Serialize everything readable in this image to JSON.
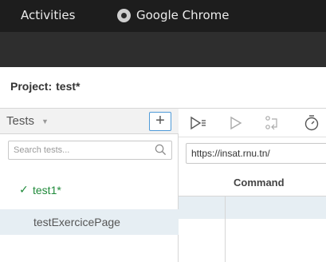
{
  "topbar": {
    "activities_label": "Activities",
    "app_name": "Google Chrome"
  },
  "project": {
    "label": "Project:",
    "name": "test*"
  },
  "tests_panel": {
    "title": "Tests",
    "add_label": "+",
    "search_placeholder": "Search tests...",
    "items": [
      {
        "label": "test1*",
        "status": "passed",
        "check": "✓"
      },
      {
        "label": "testExercicePage",
        "status": "selected"
      }
    ]
  },
  "editor": {
    "url": "https://insat.rnu.tn/",
    "command_header": "Command"
  }
}
